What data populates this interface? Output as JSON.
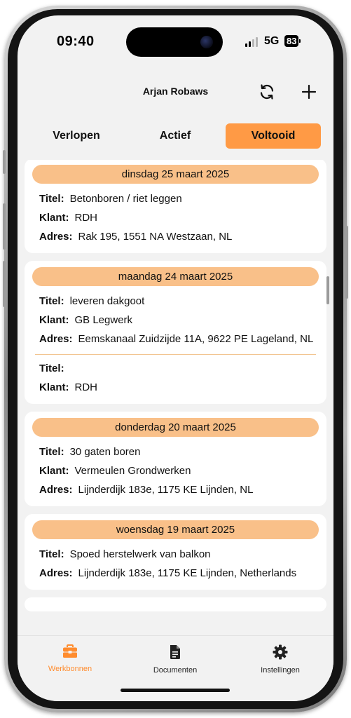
{
  "status": {
    "time": "09:40",
    "network": "5G",
    "battery": "83"
  },
  "header": {
    "title": "Arjan Robaws"
  },
  "tabs": [
    {
      "label": "Verlopen",
      "selected": false
    },
    {
      "label": "Actief",
      "selected": false
    },
    {
      "label": "Voltooid",
      "selected": true
    }
  ],
  "labels": {
    "titel": "Titel:",
    "klant": "Klant:",
    "adres": "Adres:"
  },
  "cards": [
    {
      "date": "dinsdag 25 maart 2025",
      "entries": [
        {
          "titel": "Betonboren  / riet leggen",
          "klant": "RDH",
          "adres": "Rak 195, 1551 NA Westzaan, NL"
        }
      ]
    },
    {
      "date": "maandag 24 maart 2025",
      "entries": [
        {
          "titel": "leveren dakgoot",
          "klant": "GB Legwerk",
          "adres": "Eemskanaal Zuidzijde 11A, 9622 PE Lageland, NL"
        },
        {
          "titel": "",
          "klant": "RDH"
        }
      ]
    },
    {
      "date": "donderdag 20 maart 2025",
      "entries": [
        {
          "titel": "30 gaten boren",
          "klant": "Vermeulen Grondwerken",
          "adres": "Lijnderdijk 183e, 1175 KE Lijnden, NL"
        }
      ]
    },
    {
      "date": "woensdag 19 maart 2025",
      "entries": [
        {
          "titel": "Spoed herstelwerk van balkon",
          "adres": "Lijnderdijk 183e, 1175 KE Lijnden, Netherlands"
        }
      ]
    }
  ],
  "bottom_nav": [
    {
      "label": "Werkbonnen",
      "icon": "toolbox-icon",
      "active": true
    },
    {
      "label": "Documenten",
      "icon": "document-icon",
      "active": false
    },
    {
      "label": "Instellingen",
      "icon": "gear-icon",
      "active": false
    }
  ],
  "colors": {
    "accent": "#ff9a45",
    "date_pill": "#f9c089",
    "active_nav": "#ff8c2e"
  }
}
